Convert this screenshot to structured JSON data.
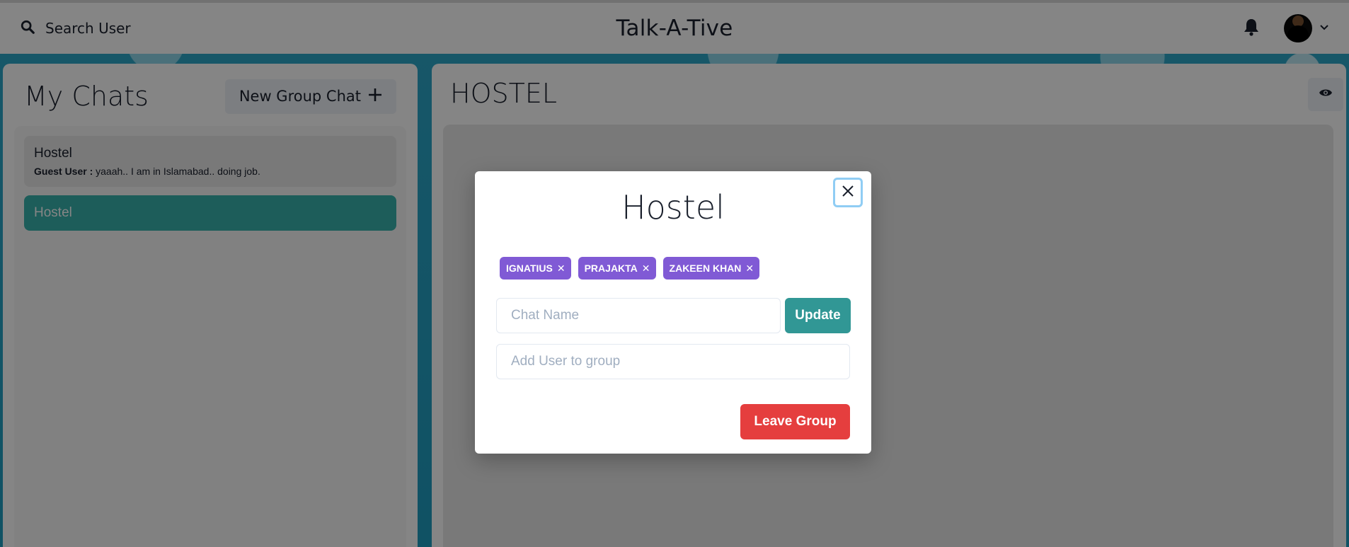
{
  "header": {
    "search_label": "Search User",
    "app_title": "Talk-A-Tive"
  },
  "sidebar": {
    "title": "My Chats",
    "new_group_label": "New Group Chat",
    "chats": [
      {
        "name": "Hostel",
        "sender": "Guest User :",
        "message": "yaaah.. I am in Islamabad.. doing job."
      },
      {
        "name": "Hostel"
      }
    ]
  },
  "chat": {
    "title": "HOSTEL"
  },
  "modal": {
    "title": "Hostel",
    "members": [
      "IGNATIUS",
      "PRAJAKTA",
      "ZAKEEN KHAN"
    ],
    "chat_name_placeholder": "Chat Name",
    "update_label": "Update",
    "add_user_placeholder": "Add User to group",
    "leave_label": "Leave Group"
  },
  "colors": {
    "accent_teal": "#319795",
    "active_chat": "#38b2ac",
    "badge_purple": "#805ad5",
    "danger_red": "#e53e3e"
  }
}
